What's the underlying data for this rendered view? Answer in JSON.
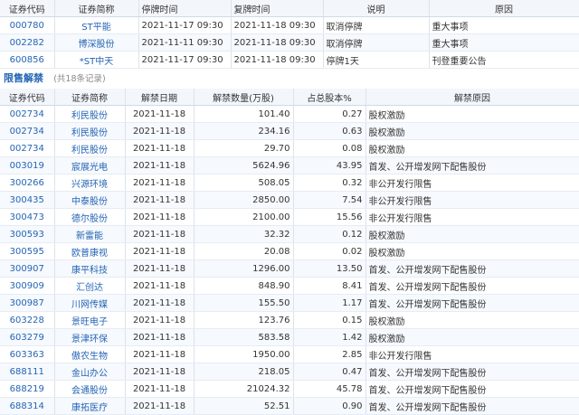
{
  "suspension": {
    "headers": [
      "证券代码",
      "证券简称",
      "停牌时间",
      "复牌时间",
      "说明",
      "原因"
    ],
    "rows": [
      {
        "code": "000780",
        "name": "ST平能",
        "stop": "2021-11-17 09:30",
        "resume": "2021-11-18 09:30",
        "note": "取消停牌",
        "reason": "重大事项"
      },
      {
        "code": "002282",
        "name": "博深股份",
        "stop": "2021-11-11 09:30",
        "resume": "2021-11-18 09:30",
        "note": "取消停牌",
        "reason": "重大事项"
      },
      {
        "code": "600856",
        "name": "*ST中天",
        "stop": "2021-11-17 09:30",
        "resume": "2021-11-18 09:30",
        "note": "停牌1天",
        "reason": "刊登重要公告"
      }
    ]
  },
  "unlock": {
    "title": "限售解禁",
    "count": "(共18条记录)",
    "headers": [
      "证券代码",
      "证券简称",
      "解禁日期",
      "解禁数量(万股)",
      "占总股本%",
      "解禁原因"
    ],
    "rows": [
      {
        "code": "002734",
        "name": "利民股份",
        "date": "2021-11-18",
        "qty": "101.40",
        "pct": "0.27",
        "reason": "股权激励"
      },
      {
        "code": "002734",
        "name": "利民股份",
        "date": "2021-11-18",
        "qty": "234.16",
        "pct": "0.63",
        "reason": "股权激励"
      },
      {
        "code": "002734",
        "name": "利民股份",
        "date": "2021-11-18",
        "qty": "29.70",
        "pct": "0.08",
        "reason": "股权激励"
      },
      {
        "code": "003019",
        "name": "宸展光电",
        "date": "2021-11-18",
        "qty": "5624.96",
        "pct": "43.95",
        "reason": "首发、公开增发网下配售股份"
      },
      {
        "code": "300266",
        "name": "兴源环境",
        "date": "2021-11-18",
        "qty": "508.05",
        "pct": "0.32",
        "reason": "非公开发行限售"
      },
      {
        "code": "300435",
        "name": "中泰股份",
        "date": "2021-11-18",
        "qty": "2850.00",
        "pct": "7.54",
        "reason": "非公开发行限售"
      },
      {
        "code": "300473",
        "name": "德尔股份",
        "date": "2021-11-18",
        "qty": "2100.00",
        "pct": "15.56",
        "reason": "非公开发行限售"
      },
      {
        "code": "300593",
        "name": "新雷能",
        "date": "2021-11-18",
        "qty": "32.32",
        "pct": "0.12",
        "reason": "股权激励"
      },
      {
        "code": "300595",
        "name": "欧普康视",
        "date": "2021-11-18",
        "qty": "20.08",
        "pct": "0.02",
        "reason": "股权激励"
      },
      {
        "code": "300907",
        "name": "康平科技",
        "date": "2021-11-18",
        "qty": "1296.00",
        "pct": "13.50",
        "reason": "首发、公开增发网下配售股份"
      },
      {
        "code": "300909",
        "name": "汇创达",
        "date": "2021-11-18",
        "qty": "848.90",
        "pct": "8.41",
        "reason": "首发、公开增发网下配售股份"
      },
      {
        "code": "300987",
        "name": "川网传媒",
        "date": "2021-11-18",
        "qty": "155.50",
        "pct": "1.17",
        "reason": "首发、公开增发网下配售股份"
      },
      {
        "code": "603228",
        "name": "景旺电子",
        "date": "2021-11-18",
        "qty": "123.76",
        "pct": "0.15",
        "reason": "股权激励"
      },
      {
        "code": "603279",
        "name": "景津环保",
        "date": "2021-11-18",
        "qty": "583.58",
        "pct": "1.42",
        "reason": "股权激励"
      },
      {
        "code": "603363",
        "name": "傲农生物",
        "date": "2021-11-18",
        "qty": "1950.00",
        "pct": "2.85",
        "reason": "非公开发行限售"
      },
      {
        "code": "688111",
        "name": "金山办公",
        "date": "2021-11-18",
        "qty": "218.05",
        "pct": "0.47",
        "reason": "首发、公开增发网下配售股份"
      },
      {
        "code": "688219",
        "name": "会通股份",
        "date": "2021-11-18",
        "qty": "21024.32",
        "pct": "45.78",
        "reason": "首发、公开增发网下配售股份"
      },
      {
        "code": "688314",
        "name": "康拓医疗",
        "date": "2021-11-18",
        "qty": "52.51",
        "pct": "0.90",
        "reason": "首发、公开增发网下配售股份"
      }
    ]
  }
}
